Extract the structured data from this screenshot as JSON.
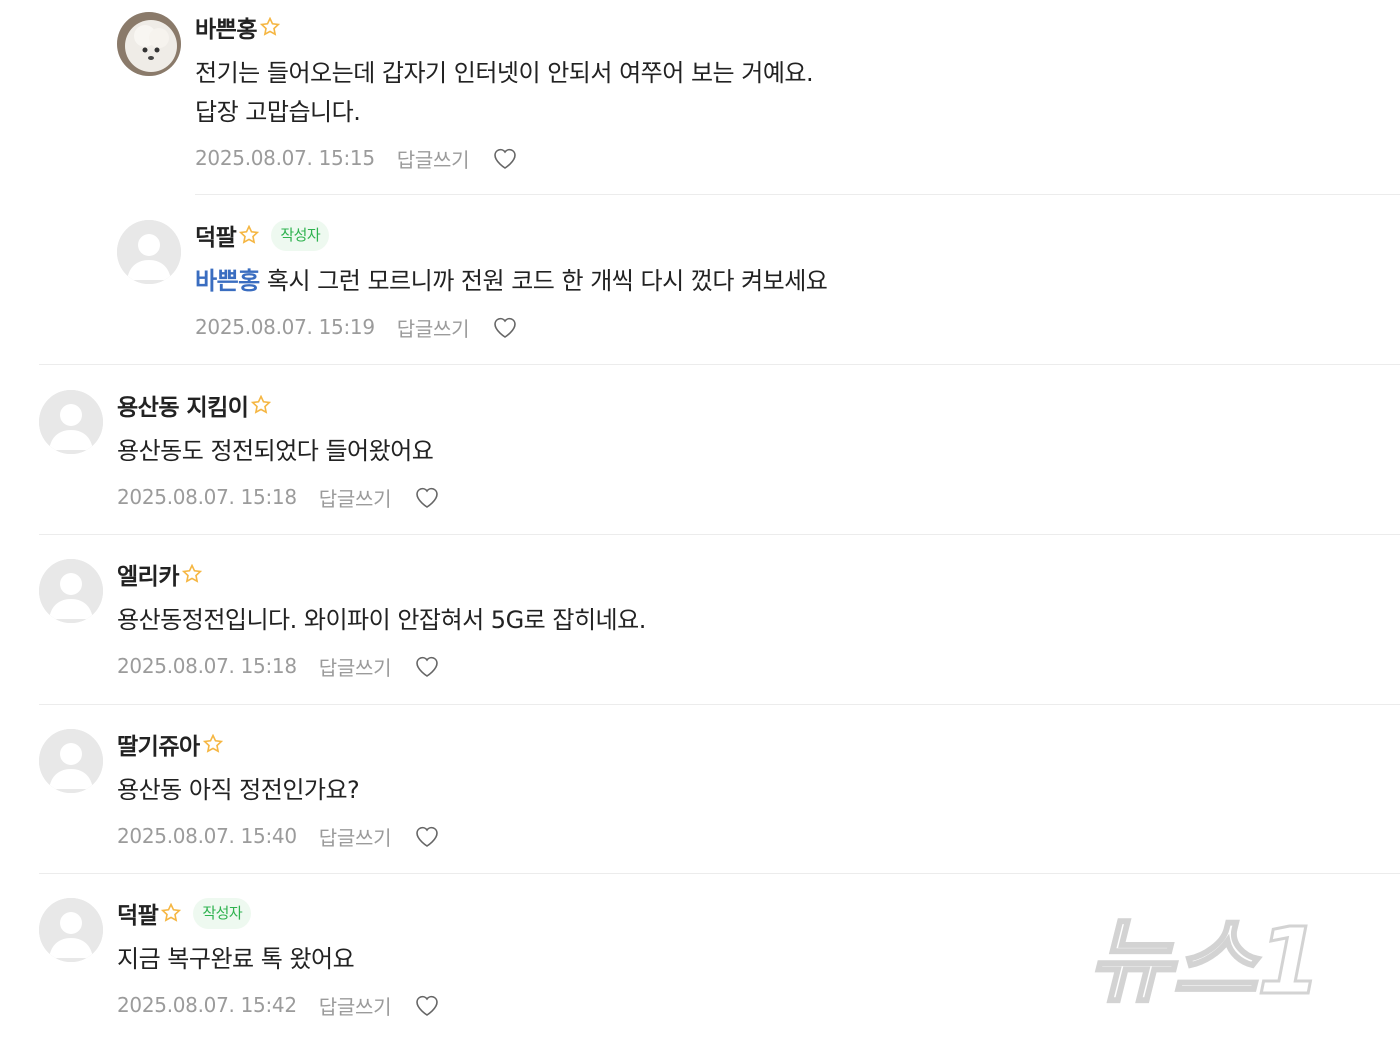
{
  "comments": [
    {
      "nickname": "바쁜홍",
      "text_lines": [
        "전기는 들어오는데 갑자기 인터넷이 안되서 여쭈어 보는 거예요.",
        "답장 고맙습니다."
      ],
      "date": "2025.08.07. 15:15",
      "reply_label": "답글쓰기"
    },
    {
      "nickname": "덕팔",
      "badge": "작성자",
      "mention": "바쁜홍",
      "text": "혹시 그런 모르니까 전원 코드 한 개씩 다시 껐다 켜보세요",
      "date": "2025.08.07. 15:19",
      "reply_label": "답글쓰기"
    },
    {
      "nickname": "용산동 지킴이",
      "text": "용산동도 정전되었다 들어왔어요",
      "date": "2025.08.07. 15:18",
      "reply_label": "답글쓰기"
    },
    {
      "nickname": "엘리카",
      "text": "용산동정전입니다. 와이파이 안잡혀서 5G로 잡히네요.",
      "date": "2025.08.07. 15:18",
      "reply_label": "답글쓰기"
    },
    {
      "nickname": "딸기쥬아",
      "text": "용산동 아직 정전인가요?",
      "date": "2025.08.07. 15:40",
      "reply_label": "답글쓰기"
    },
    {
      "nickname": "덕팔",
      "badge": "작성자",
      "text": "지금 복구완료 톡 왔어요",
      "date": "2025.08.07. 15:42",
      "reply_label": "답글쓰기"
    }
  ],
  "watermark": "뉴스1",
  "colors": {
    "mention": "#3a6dc0",
    "badge_text": "#2fb24f",
    "badge_bg": "#eef9f0",
    "star": "#f5c242",
    "meta": "#9b9b9b"
  }
}
